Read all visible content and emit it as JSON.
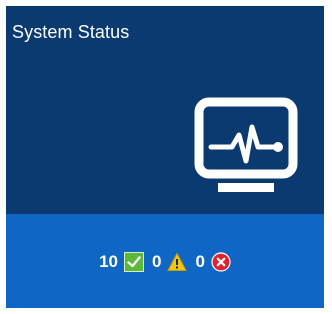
{
  "tile": {
    "title": "System Status"
  },
  "icons": {
    "main": "monitor-heartbeat-icon",
    "ok": "check-icon",
    "warning": "warning-icon",
    "error": "error-icon"
  },
  "status": {
    "ok_count": "10",
    "warning_count": "0",
    "error_count": "0"
  },
  "colors": {
    "tile_background": "#0a3a70",
    "status_bar": "#1066c4",
    "ok": "#5cb83a",
    "warning": "#f2c811",
    "error": "#e0242f"
  }
}
